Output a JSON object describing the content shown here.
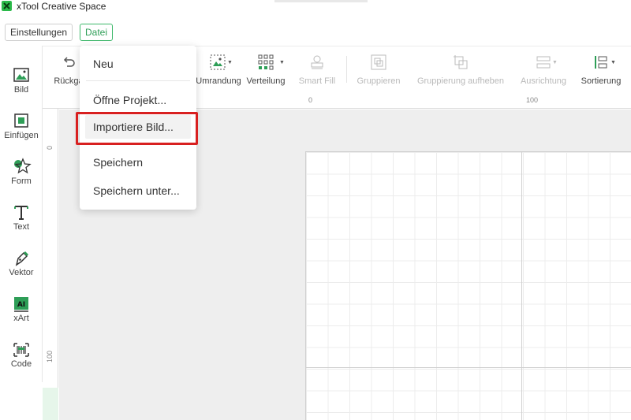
{
  "app": {
    "title": "xTool Creative Space"
  },
  "menubar": {
    "settings_label": "Einstellungen",
    "file_label": "Datei"
  },
  "file_menu": {
    "items": [
      "Neu",
      "Öffne Projekt...",
      "Importiere Bild...",
      "Speichern",
      "Speichern unter..."
    ],
    "highlighted_item": "Importiere Bild..."
  },
  "sidebar": {
    "items": [
      {
        "label": "Bild",
        "icon": "image-icon"
      },
      {
        "label": "Einfügen",
        "icon": "insert-icon"
      },
      {
        "label": "Form",
        "icon": "shape-icon"
      },
      {
        "label": "Text",
        "icon": "text-icon"
      },
      {
        "label": "Vektor",
        "icon": "pen-icon"
      },
      {
        "label": "xArt",
        "icon": "ai-icon"
      },
      {
        "label": "Code",
        "icon": "barcode-icon"
      }
    ]
  },
  "toolbar": {
    "undo_label": "Rückgä",
    "border_label": "Umrandung",
    "distribution_label": "Verteilung",
    "smartfill_label": "Smart Fill",
    "group_label": "Gruppieren",
    "ungroup_label": "Gruppierung aufheben",
    "align_label": "Ausrichtung",
    "sort_label": "Sortierung"
  },
  "rulers": {
    "top": [
      "0",
      "100"
    ],
    "left": [
      "0",
      "100"
    ]
  },
  "colors": {
    "accent": "#2e9e57",
    "highlight": "#d82020"
  }
}
